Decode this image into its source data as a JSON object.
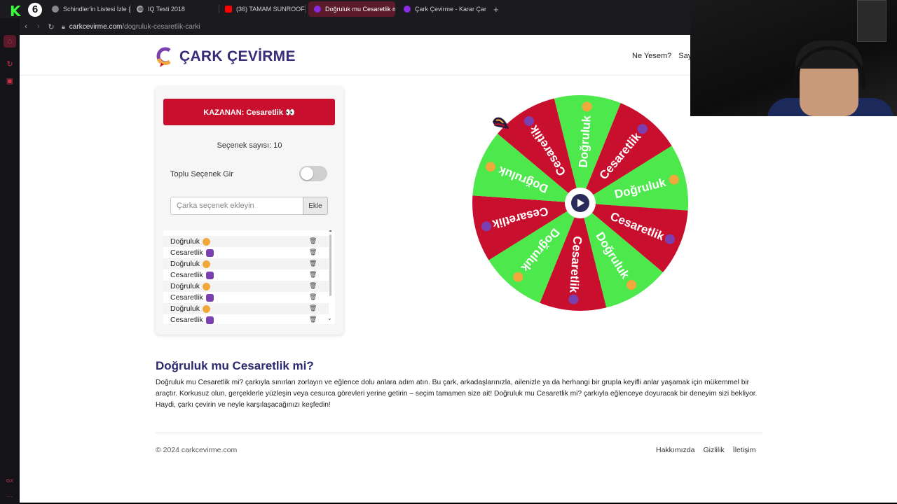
{
  "browser": {
    "tabs": [
      {
        "label": "Schindler'in Listesi İzle | F",
        "favicon_color": "#888888",
        "active": false
      },
      {
        "label": "IQ Testi 2018",
        "favicon_color": "#666666",
        "active": false
      },
      {
        "label": "(36) TAMAM SUNROOF |",
        "favicon_color": "#ff0000",
        "active": false
      },
      {
        "label": "Doğruluk mu Cesaretlik m",
        "favicon_color": "#8a2be2",
        "active": true
      },
      {
        "label": "Çark Çevirme - Karar Çar",
        "favicon_color": "#8a2be2",
        "active": false
      }
    ],
    "new_tab": "+",
    "url_host": "carkcevirme.com",
    "url_path": "/dogruluk-cesaretlik-carki",
    "stream_logo_k": "K",
    "stream_logo_6": "6"
  },
  "site": {
    "brand": "ÇARK ÇEVİRME",
    "nav": [
      "Ne Yesem?",
      "Sayı"
    ]
  },
  "panel": {
    "winner": "KAZANAN: Cesaretlik 👀",
    "option_count": "Seçenek sayısı: 10",
    "bulk_label": "Toplu Seçenek Gir",
    "bulk_enabled": false,
    "input_placeholder": "Çarka seçenek ekleyin",
    "input_value": "",
    "add_button": "Ekle",
    "options": [
      "Doğruluk",
      "Cesaretlik",
      "Doğruluk",
      "Cesaretlik",
      "Doğruluk",
      "Cesaretlik",
      "Doğruluk",
      "Cesaretlik"
    ],
    "option_kinds": [
      "truth",
      "dare",
      "truth",
      "dare",
      "truth",
      "dare",
      "truth",
      "dare"
    ]
  },
  "wheel": {
    "segments": [
      "Doğruluk",
      "Cesaretlik",
      "Doğruluk",
      "Cesaretlik",
      "Doğruluk",
      "Cesaretlik",
      "Doğruluk",
      "Cesaretlik",
      "Doğruluk",
      "Cesaretlik"
    ],
    "colors": {
      "truth": "#4ce84c",
      "dare": "#c8102e"
    },
    "rotation_deg": -14
  },
  "article": {
    "title": "Doğruluk mu Cesaretlik mi?",
    "body": "Doğruluk mu Cesaretlik mi? çarkıyla sınırları zorlayın ve eğlence dolu anlara adım atın. Bu çark, arkadaşlarınızla, ailenizle ya da herhangi bir grupla keyifli anlar yaşamak için mükemmel bir araçtır. Korkusuz olun, gerçeklerle yüzleşin veya cesurca görevleri yerine getirin – seçim tamamen size ait! Doğruluk mu Cesaretlik mi? çarkıyla eğlenceye doyuracak bir deneyim sizi bekliyor. Haydi, çarkı çevirin ve neyle karşılaşacağınızı keşfedin!"
  },
  "footer": {
    "copyright": "© 2024 carkcevirme.com",
    "links": [
      "Hakkımızda",
      "Gizlilik",
      "İletişim"
    ]
  },
  "colors": {
    "accent": "#c8102e",
    "brand_text": "#3a2a7a"
  }
}
